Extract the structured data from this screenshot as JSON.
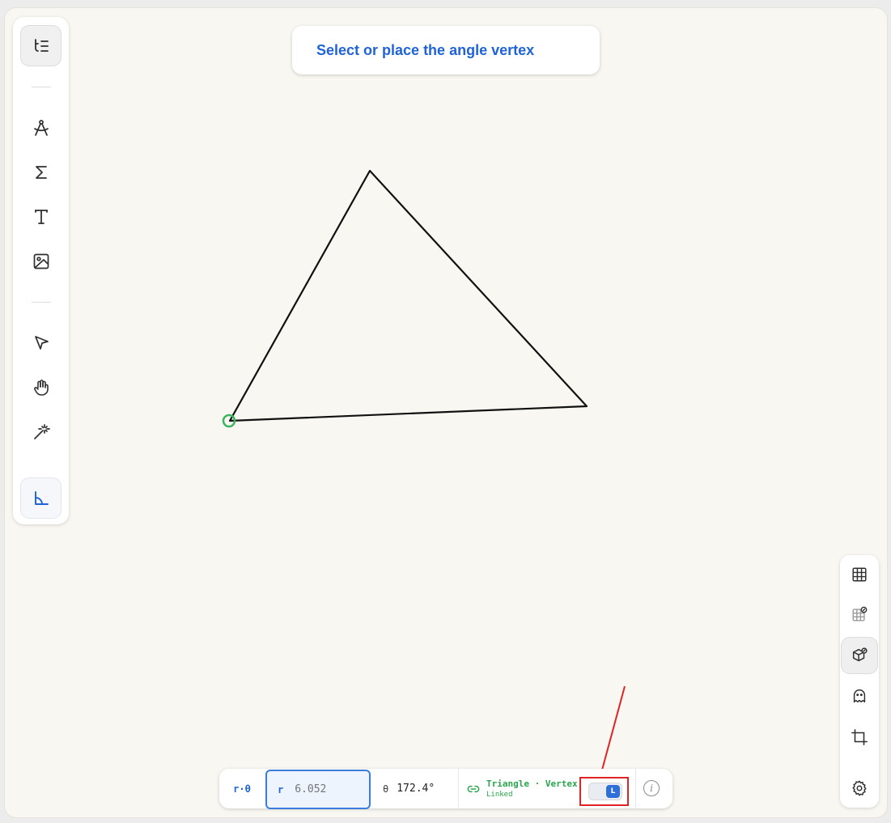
{
  "hint": {
    "text": "Select or place the angle vertex"
  },
  "toolbar": {
    "items": [
      {
        "name": "outline-list-icon"
      },
      {
        "name": "compass-icon"
      },
      {
        "name": "sigma-icon"
      },
      {
        "name": "text-icon"
      },
      {
        "name": "image-icon"
      },
      {
        "name": "pointer-icon"
      },
      {
        "name": "hand-icon"
      },
      {
        "name": "magic-wand-icon"
      },
      {
        "name": "angle-tool-icon"
      }
    ]
  },
  "right_panel": {
    "items": [
      {
        "name": "grid-icon"
      },
      {
        "name": "grid-snap-icon"
      },
      {
        "name": "cube-snap-icon"
      },
      {
        "name": "ghost-icon"
      },
      {
        "name": "crop-icon"
      },
      {
        "name": "settings-icon"
      }
    ]
  },
  "statusbar": {
    "mode": "r·θ",
    "r_label": "r",
    "r_placeholder": "6.052",
    "theta_symbol": "θ",
    "theta_value": "172.4°",
    "link_main": "Triangle · Vertex",
    "link_sub": "Linked",
    "toggle_label": "L"
  },
  "colors": {
    "accent": "#1f63d8",
    "linked": "#2aa44d",
    "highlight": "#e02424",
    "canvas": "#f8f7f1"
  }
}
